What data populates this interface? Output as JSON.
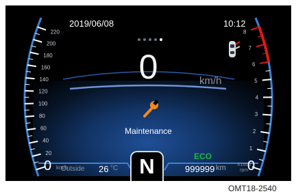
{
  "status_bar": {
    "date": "2019/06/08",
    "time": "10:12"
  },
  "speedometer": {
    "value": "0",
    "unit": "km/h",
    "scale_labels": [
      "20",
      "40",
      "60",
      "80",
      "100",
      "120",
      "140",
      "160",
      "180",
      "200",
      "220"
    ],
    "zero_label": "0",
    "zero_unit": "km/h"
  },
  "tachometer": {
    "scale_labels": [
      "1",
      "2",
      "3",
      "4",
      "5",
      "6",
      "7",
      "8"
    ],
    "zero_label": "0",
    "unit_line1": "X1000",
    "unit_line2": "rpm",
    "redline_from": 6
  },
  "maintenance": {
    "label": "Maintenance",
    "icon": "wrench-icon",
    "icon_color": "#f28a1c"
  },
  "gear": {
    "value": "N"
  },
  "drive_mode": {
    "label": "ECO",
    "color": "#1fb548"
  },
  "odometer": {
    "value": "999999",
    "unit": "km"
  },
  "outside_temperature": {
    "label": "Outside",
    "value": "26",
    "unit": "°C"
  },
  "page_indicator": {
    "count": 5,
    "active_index": 4
  },
  "car_icon": {
    "icon": "car-doors-open-icon"
  },
  "caption": "OMT18-2540",
  "colors": {
    "gauge_blue": "#3b82d6",
    "redline": "#e01818",
    "background": "#000000"
  }
}
